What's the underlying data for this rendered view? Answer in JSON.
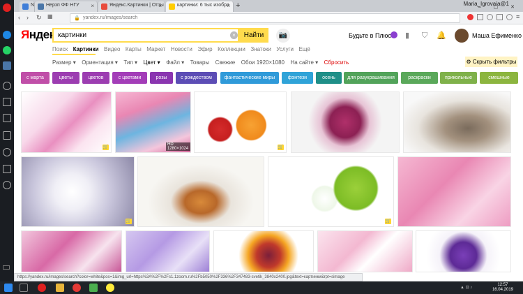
{
  "browser": {
    "tabs": [
      {
        "label": "N",
        "fav": "#3f7ed8"
      },
      {
        "label": "Нерзп ФФ НГУ",
        "fav": "#4a76a8"
      },
      {
        "label": "Яндекс.Картинки | Отзы",
        "fav": "#e84c3d"
      },
      {
        "label": "картинки: 6 тыс изобра",
        "fav": "#ffcc00"
      }
    ],
    "new_tab": "+",
    "user": "Maria_Igrovaia@1",
    "url": "yandex.ru/images/search"
  },
  "header": {
    "logo_ya": "Я",
    "logo_rest": "ндекс",
    "query": "картинки",
    "search_button": "Найти",
    "plus_link": "Будьте в Плюсе",
    "user_name": "Маша Ефименко"
  },
  "services": [
    "Поиск",
    "Картинки",
    "Видео",
    "Карты",
    "Маркет",
    "Новости",
    "Эфир",
    "Коллекции",
    "Знатоки",
    "Услуги",
    "Ещё"
  ],
  "filters": {
    "items": [
      "Размер ▾",
      "Ориентация ▾",
      "Тип ▾",
      "Цвет ▾",
      "Файл ▾",
      "Товары",
      "Свежие",
      "Обои 1920×1080",
      "На сайте ▾"
    ],
    "reset": "Сбросить",
    "hide_filters": "Скрыть фильтры"
  },
  "chips": [
    {
      "label": "с марта",
      "color": "#c04fa8"
    },
    {
      "label": "цветы",
      "color": "#9c3db1"
    },
    {
      "label": "цветов",
      "color": "#9c3db1"
    },
    {
      "label": "с цветами",
      "color": "#a33db8"
    },
    {
      "label": "розы",
      "color": "#8a35b0"
    },
    {
      "label": "с рождеством",
      "color": "#5c4db5"
    },
    {
      "label": "фантастические миры",
      "color": "#2f9ad9"
    },
    {
      "label": "фэнтези",
      "color": "#2fa3d8"
    },
    {
      "label": "осень",
      "color": "#1f8f88"
    },
    {
      "label": "для разукрашивания",
      "color": "#52a35a"
    },
    {
      "label": "раскраски",
      "color": "#5aa85a"
    },
    {
      "label": "прикольные",
      "color": "#7fb14a"
    },
    {
      "label": "смешные",
      "color": "#8cb53f"
    }
  ],
  "images": {
    "hd_badge": "HD 1280×1024",
    "cart_icon": "🛒"
  },
  "status_url": "https://yandex.ru/images/search?color=white&pos=1&img_url=https%3A%2F%2Fs1.1zoom.ru%2Fb5050%2F336%2F347483-svetik_3840x2400.jpg&text=картинки&rpt=simage",
  "taskbar": {
    "time": "12:57",
    "date": "16.04.2019"
  }
}
